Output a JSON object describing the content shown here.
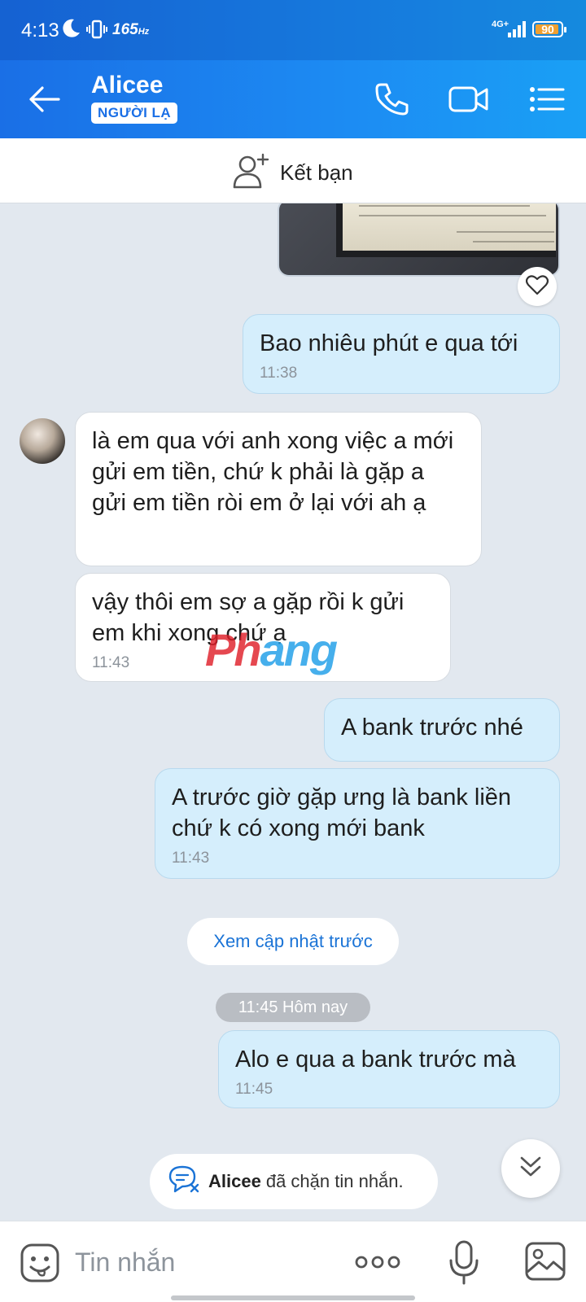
{
  "status_bar": {
    "time": "4:13",
    "refresh_rate": "165",
    "refresh_unit": "Hz",
    "network": "4G+",
    "battery": "90"
  },
  "header": {
    "title": "Alicee",
    "badge": "NGƯỜI LẠ"
  },
  "add_friend": {
    "label": "Kết bạn"
  },
  "messages": [
    {
      "dir": "out",
      "text": "Bao nhiêu phút e qua tới",
      "time": "11:38"
    },
    {
      "dir": "in",
      "text": "là em qua với anh xong việc a mới gửi em tiền, chứ k phải là gặp a gửi em tiền ròi em ở lại với ah ạ"
    },
    {
      "dir": "in",
      "text": "vậy thôi em sợ a gặp rồi k gửi em khi xong chứ ạ",
      "time": "11:43"
    },
    {
      "dir": "out",
      "text": "A bank trước nhé"
    },
    {
      "dir": "out",
      "text": "A trước giờ gặp ưng là bank liền chứ k có xong mới bank",
      "time": "11:43"
    },
    {
      "dir": "out",
      "text": "Alo e qua a bank trước mà",
      "time": "11:45"
    }
  ],
  "watermark": {
    "part1": "Ph",
    "part2": "ang"
  },
  "prev_updates": "Xem cập nhật trước",
  "date_divider": "11:45 Hôm nay",
  "blocked_notice": {
    "name": "Alicee",
    "text": "đã chặn tin nhắn."
  },
  "composer": {
    "placeholder": "Tin nhắn"
  },
  "colors": {
    "header_blue": "#1a6fe6",
    "bubble_out": "#d5eefc",
    "bubble_in": "#ffffff",
    "link_blue": "#1a73d6"
  }
}
